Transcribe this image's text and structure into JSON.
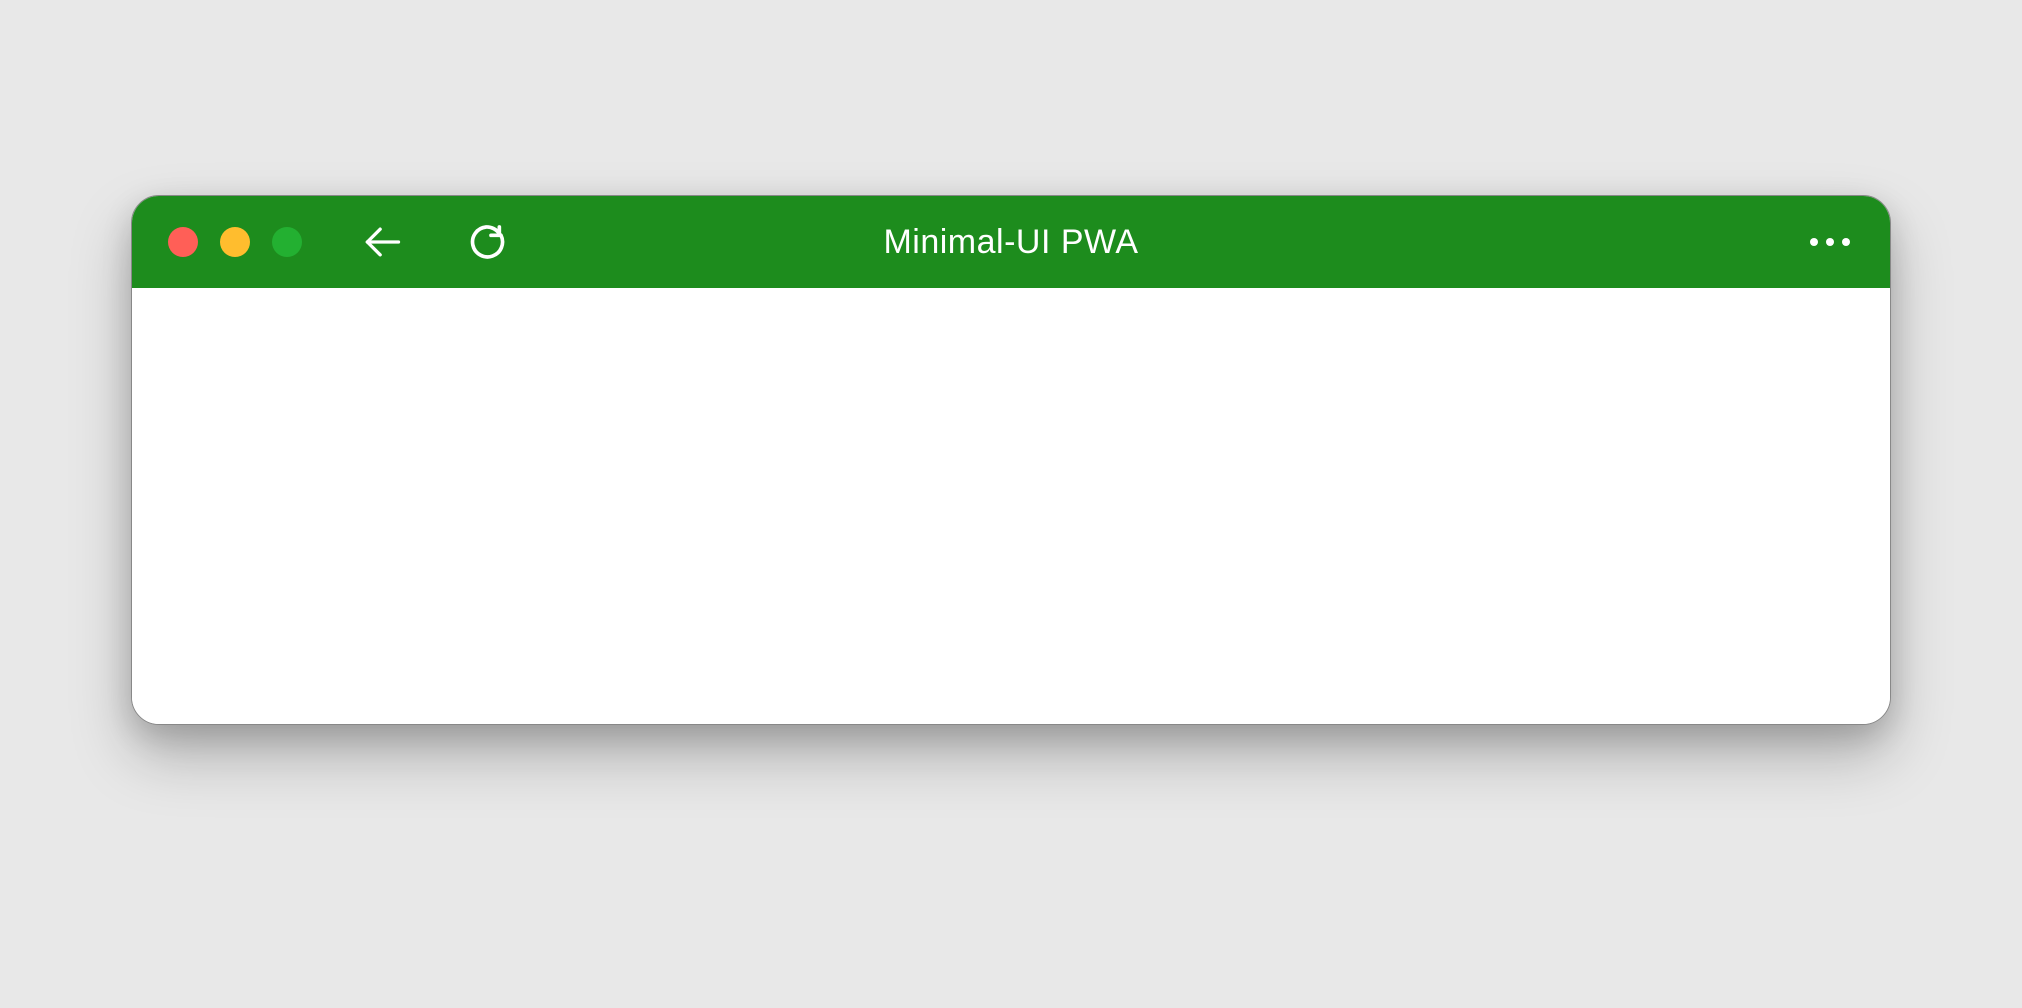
{
  "window": {
    "title": "Minimal-UI PWA"
  },
  "colors": {
    "titlebar": "#1d8c1d",
    "traffic_close": "#ff5f57",
    "traffic_minimize": "#ffbd2e",
    "traffic_maximize": "#28c840"
  },
  "icons": {
    "back": "arrow-left",
    "reload": "reload",
    "more": "more-horizontal"
  }
}
